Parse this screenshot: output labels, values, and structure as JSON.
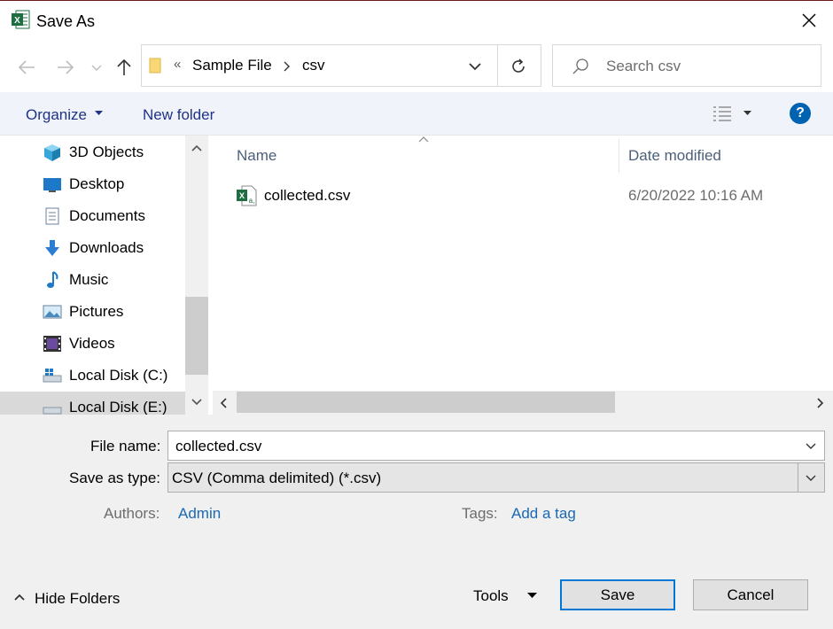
{
  "window": {
    "title": "Save As"
  },
  "navigation": {
    "breadcrumb_overflow": "«",
    "breadcrumb": [
      "Sample File",
      "csv"
    ],
    "search_placeholder": "Search csv"
  },
  "commandbar": {
    "organize": "Organize",
    "new_folder": "New folder",
    "help": "?"
  },
  "sidebar": {
    "items": [
      {
        "label": "3D Objects",
        "icon": "3d-objects-icon"
      },
      {
        "label": "Desktop",
        "icon": "desktop-icon"
      },
      {
        "label": "Documents",
        "icon": "documents-icon"
      },
      {
        "label": "Downloads",
        "icon": "downloads-icon"
      },
      {
        "label": "Music",
        "icon": "music-icon"
      },
      {
        "label": "Pictures",
        "icon": "pictures-icon"
      },
      {
        "label": "Videos",
        "icon": "videos-icon"
      },
      {
        "label": "Local Disk (C:)",
        "icon": "drive-icon"
      },
      {
        "label": "Local Disk (E:)",
        "icon": "drive-icon",
        "selected": true
      }
    ]
  },
  "filelist": {
    "columns": [
      "Name",
      "Date modified"
    ],
    "files": [
      {
        "name": "collected.csv",
        "date": "6/20/2022 10:16 AM"
      }
    ]
  },
  "form": {
    "filename_label": "File name:",
    "filename_value": "collected.csv",
    "type_label": "Save as type:",
    "type_value": "CSV (Comma delimited) (*.csv)",
    "authors_label": "Authors:",
    "authors_value": "Admin",
    "tags_label": "Tags:",
    "tags_value": "Add a tag"
  },
  "footer": {
    "hide_folders": "Hide Folders",
    "tools": "Tools",
    "save": "Save",
    "cancel": "Cancel"
  },
  "colors": {
    "accent": "#0078d7",
    "link": "#1a68b0",
    "excel_green": "#1d6f42"
  }
}
